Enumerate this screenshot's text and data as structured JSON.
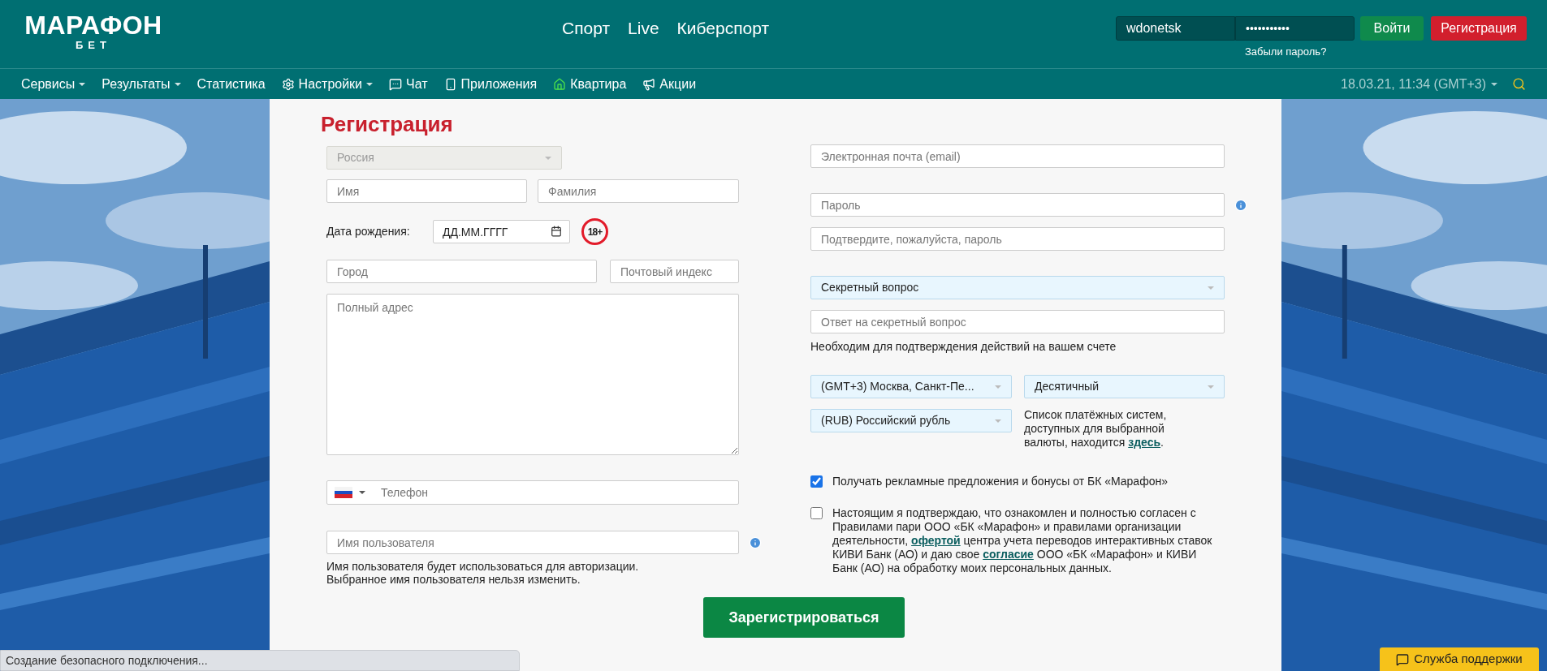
{
  "header": {
    "logo": {
      "title": "МАРАФОН",
      "subtitle": "БЕТ"
    },
    "top_nav": [
      "Спорт",
      "Live",
      "Киберспорт"
    ],
    "login": {
      "username": {
        "value": "wdonetsk"
      },
      "password": {
        "value": "•••••••••••"
      },
      "login_button": "Войти",
      "register_button": "Регистрация",
      "forgot_link": "Забыли пароль?"
    }
  },
  "nav": {
    "items": [
      {
        "label": "Сервисы",
        "dropdown": true
      },
      {
        "label": "Результаты",
        "dropdown": true
      },
      {
        "label": "Статистика",
        "dropdown": false
      },
      {
        "label": "Настройки",
        "dropdown": true
      },
      {
        "label": "Чат",
        "dropdown": false
      },
      {
        "label": "Приложения",
        "dropdown": false
      },
      {
        "label": "Квартира",
        "dropdown": false
      },
      {
        "label": "Акции",
        "dropdown": false
      }
    ],
    "datetime": "18.03.21, 11:34 (GMT+3)"
  },
  "form": {
    "title": "Регистрация",
    "country": {
      "value": "Россия",
      "disabled": true
    },
    "first_name": {
      "placeholder": "Имя"
    },
    "last_name": {
      "placeholder": "Фамилия"
    },
    "birth_date": {
      "label": "Дата рождения:",
      "placeholder": "ДД.ММ.ГГГГ"
    },
    "age_badge": "18+",
    "city": {
      "placeholder": "Город"
    },
    "postcode": {
      "placeholder": "Почтовый индекс"
    },
    "address": {
      "placeholder": "Полный адрес"
    },
    "phone": {
      "placeholder": "Телефон"
    },
    "username": {
      "placeholder": "Имя пользователя"
    },
    "username_note": [
      "Имя пользователя будет использоваться для авторизации.",
      "Выбранное имя пользователя нельзя изменить."
    ],
    "email": {
      "placeholder": "Электронная почта (email)"
    },
    "password": {
      "placeholder": "Пароль"
    },
    "password_confirm": {
      "placeholder": "Подтвердите, пожалуйста, пароль"
    },
    "secret_question": {
      "value": "Секретный вопрос"
    },
    "secret_answer": {
      "placeholder": "Ответ на секретный вопрос"
    },
    "answer_note": "Необходим для подтверждения действий на вашем счете",
    "timezone": {
      "value": "(GMT+3) Москва, Санкт-Пе..."
    },
    "odds_format": {
      "value": "Десятичный"
    },
    "currency": {
      "value": "(RUB) Российский рубль"
    },
    "payment_note": [
      {
        "kind": "text",
        "text": "Список платёжных систем, доступных для выбранной валюты, находится "
      },
      {
        "kind": "link",
        "text": "здесь"
      },
      {
        "kind": "text",
        "text": "."
      }
    ],
    "checkboxes": [
      {
        "checked": true,
        "parts": [
          {
            "kind": "text",
            "text": "Получать рекламные предложения и бонусы от БК «Марафон»"
          }
        ]
      },
      {
        "checked": false,
        "parts": [
          {
            "kind": "text",
            "text": "Настоящим я подтверждаю, что ознакомлен и полностью согласен с Правилами пари ООО «БК «Марафон» и правилами организации деятельности, "
          },
          {
            "kind": "link",
            "text": "офертой"
          },
          {
            "kind": "text",
            "text": " центра учета переводов интерактивных ставок КИВИ Банк (АО) и даю свое "
          },
          {
            "kind": "link",
            "text": "согласие"
          },
          {
            "kind": "text",
            "text": " ООО «БК «Марафон» и КИВИ Банк (АО) на обработку моих персональных данных."
          }
        ]
      }
    ],
    "submit_button": "Зарегистрироваться"
  },
  "status_bar": "Создание безопасного подключения...",
  "support_button": "Служба поддержки"
}
